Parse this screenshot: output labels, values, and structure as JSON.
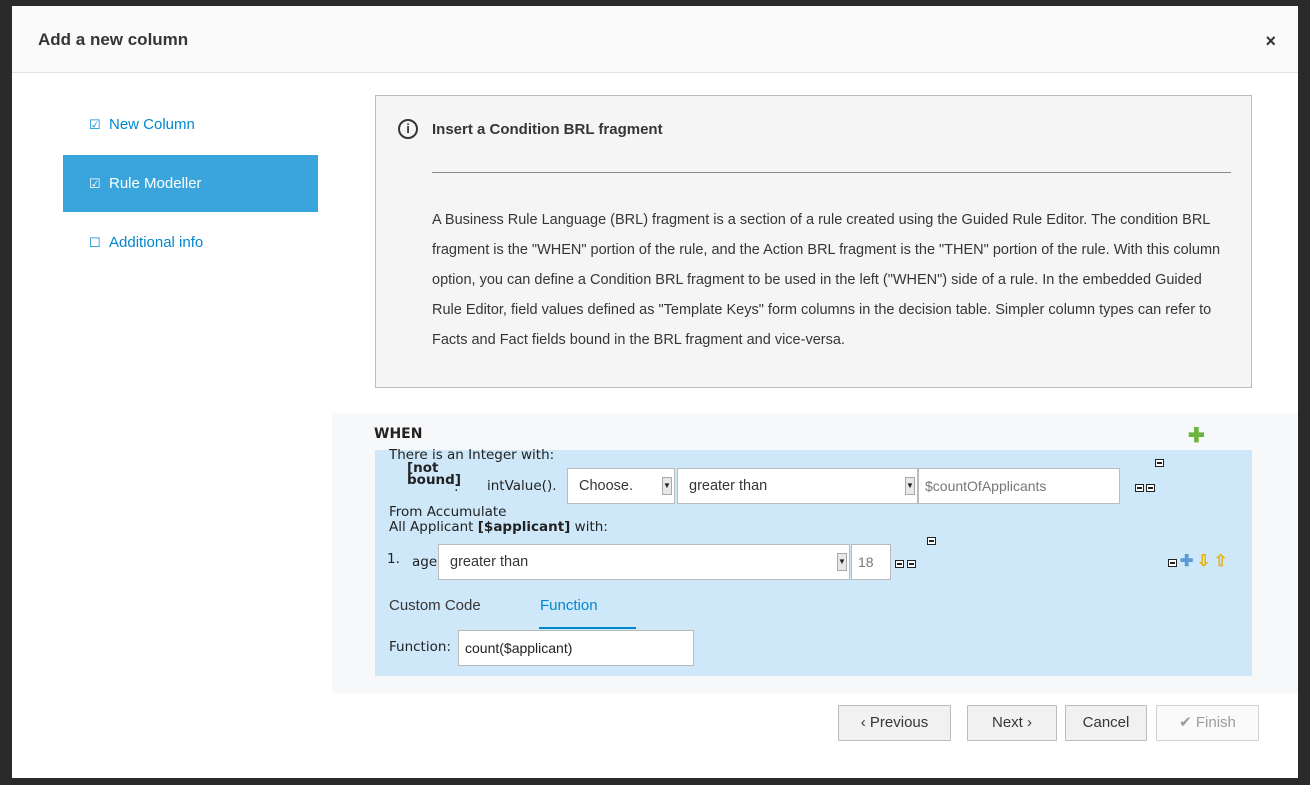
{
  "dialog": {
    "title": "Add a new column",
    "close_glyph": "×"
  },
  "nav": {
    "items": [
      {
        "label": "New Column",
        "state": "checked"
      },
      {
        "label": "Rule Modeller",
        "state": "checked",
        "active": true
      },
      {
        "label": "Additional info",
        "state": "unchecked"
      }
    ],
    "checked_glyph": "☑",
    "unchecked_glyph": "☐"
  },
  "info": {
    "icon": "info-circle-icon",
    "icon_glyph": "i",
    "title": "Insert a Condition BRL fragment",
    "body": "A Business Rule Language (BRL) fragment is a section of a rule created using the Guided Rule Editor. The condition BRL fragment is the \"WHEN\" portion of the rule, and the Action BRL fragment is the \"THEN\" portion of the rule. With this column option, you can define a Condition BRL fragment to be used in the left (\"WHEN\") side of a rule. In the embedded Guided Rule Editor, field values defined as \"Template Keys\" form columns in the decision table. Simpler column types can refer to Facts and Fact fields bound in the BRL fragment and vice-versa."
  },
  "modeller": {
    "when_label": "WHEN",
    "pattern_header": "There is an Integer with:",
    "binding_label": "[not bound]",
    "binding_line1": "[not",
    "binding_line2": "bound]",
    "binding_suffix": ":",
    "field_label": "intValue().",
    "choose_value": "Choose.",
    "operator_value": "greater than",
    "value_field": "$countOfApplicants",
    "from_accumulate": "From Accumulate",
    "all_applicant_prefix": "All Applicant ",
    "all_applicant_binding": "[$applicant]",
    "all_applicant_suffix": " with:",
    "constraint_index": "1.",
    "constraint_field": "age",
    "constraint_operator": "greater than",
    "constraint_value": "18",
    "tabs": [
      {
        "label": "Custom Code",
        "active": false
      },
      {
        "label": "Function",
        "active": true
      }
    ],
    "function_label": "Function:",
    "function_value": "count($applicant)",
    "dropdown_glyph": "▼",
    "add_glyph": "✚",
    "down_glyph": "⇩",
    "up_glyph": "⇧"
  },
  "footer": {
    "previous_label": "‹ Previous",
    "next_label": "Next ›",
    "cancel_label": "Cancel",
    "finish_label": "✔ Finish"
  },
  "colors": {
    "accent": "#0088ce",
    "active_nav": "#39a5dc",
    "pattern_bg": "#cfe8f9"
  }
}
